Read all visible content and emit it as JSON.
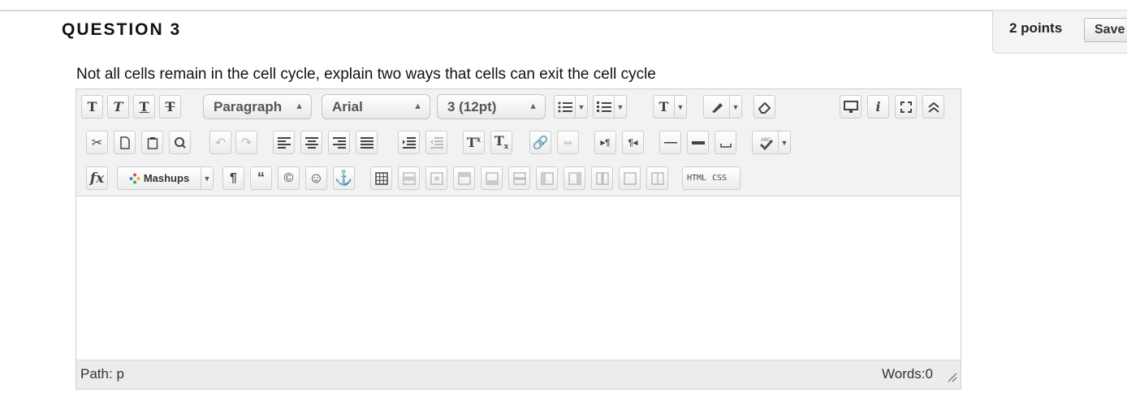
{
  "question": {
    "title": "QUESTION 3",
    "points": "2 points",
    "save_label": "Save",
    "text": "Not all cells remain in the cell cycle, explain two ways that cells can exit the cell cycle"
  },
  "toolbar": {
    "format_select": "Paragraph",
    "font_select": "Arial",
    "size_select": "3 (12pt)",
    "mashups_label": "Mashups",
    "html_label": "HTML",
    "css_label": "CSS",
    "fx_label": "fx"
  },
  "status": {
    "path_label": "Path:",
    "path_value": "p",
    "words": "Words:0"
  }
}
